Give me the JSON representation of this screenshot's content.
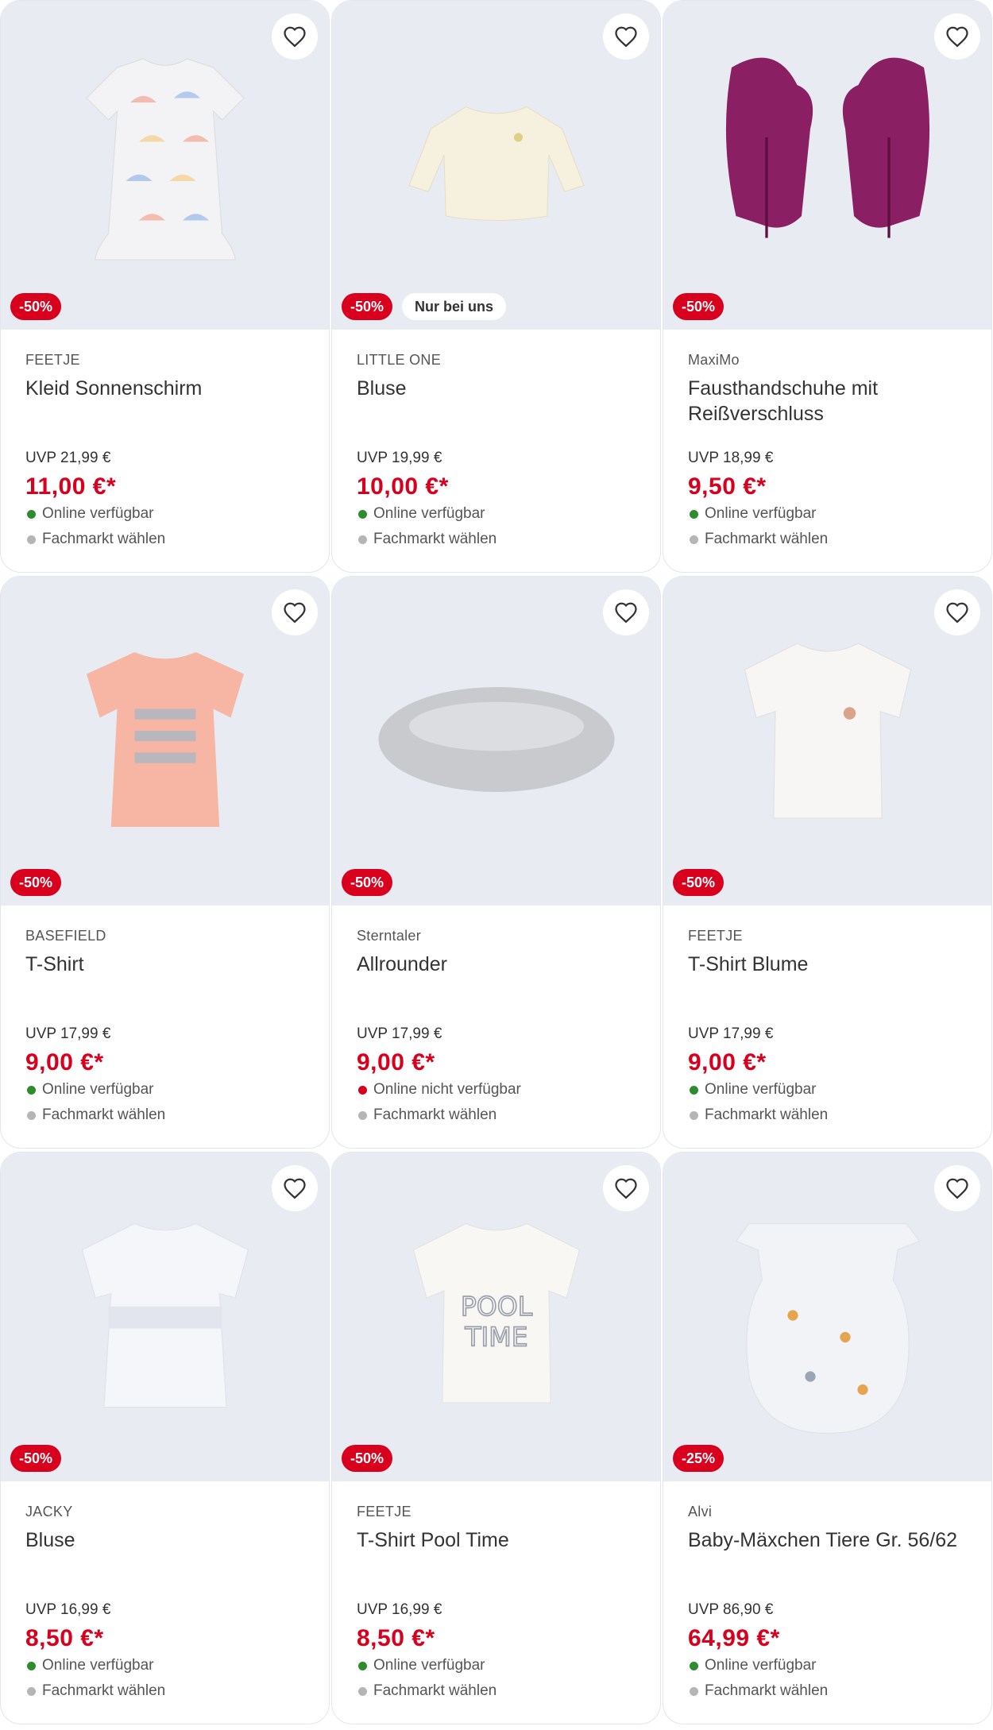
{
  "colors": {
    "accent": "#d8001c",
    "image_bg": "#e9ebf3",
    "available": "#2e8b2e",
    "unavailable": "#d8001c",
    "store_dot": "#b5b5b5"
  },
  "products": [
    {
      "image": "dress-umbrella-print",
      "discount": "-50%",
      "extra_badge": "",
      "brand": "FEETJE",
      "title": "Kleid Sonnenschirm",
      "uvp": "UVP 21,99 €",
      "price": "11,00 €*",
      "availability": "Online verfügbar",
      "available": true,
      "store": "Fachmarkt wählen"
    },
    {
      "image": "cream-blouse",
      "discount": "-50%",
      "extra_badge": "Nur bei uns",
      "brand": "LITTLE ONE",
      "title": "Bluse",
      "uvp": "UVP 19,99 €",
      "price": "10,00 €*",
      "availability": "Online verfügbar",
      "available": true,
      "store": "Fachmarkt wählen"
    },
    {
      "image": "purple-mittens",
      "discount": "-50%",
      "extra_badge": "",
      "brand": "MaxiMo",
      "title": "Fausthandschuhe mit Reißverschluss",
      "uvp": "UVP 18,99 €",
      "price": "9,50 €*",
      "availability": "Online verfügbar",
      "available": true,
      "store": "Fachmarkt wählen"
    },
    {
      "image": "peach-ruffle-tshirt",
      "discount": "-50%",
      "extra_badge": "",
      "brand": "BASEFIELD",
      "title": "T-Shirt",
      "uvp": "UVP 17,99 €",
      "price": "9,00 €*",
      "availability": "Online verfügbar",
      "available": true,
      "store": "Fachmarkt wählen"
    },
    {
      "image": "grey-loop-scarf",
      "discount": "-50%",
      "extra_badge": "",
      "brand": "Sterntaler",
      "title": "Allrounder",
      "uvp": "UVP 17,99 €",
      "price": "9,00 €*",
      "availability": "Online nicht verfügbar",
      "available": false,
      "store": "Fachmarkt wählen"
    },
    {
      "image": "white-tshirt-flower",
      "discount": "-50%",
      "extra_badge": "",
      "brand": "FEETJE",
      "title": "T-Shirt Blume",
      "uvp": "UVP 17,99 €",
      "price": "9,00 €*",
      "availability": "Online verfügbar",
      "available": true,
      "store": "Fachmarkt wählen"
    },
    {
      "image": "white-lace-blouse",
      "discount": "-50%",
      "extra_badge": "",
      "brand": "JACKY",
      "title": "Bluse",
      "uvp": "UVP 16,99 €",
      "price": "8,50 €*",
      "availability": "Online verfügbar",
      "available": true,
      "store": "Fachmarkt wählen"
    },
    {
      "image": "pool-time-tshirt",
      "discount": "-50%",
      "extra_badge": "",
      "brand": "FEETJE",
      "title": "T-Shirt Pool Time",
      "uvp": "UVP 16,99 €",
      "price": "8,50 €*",
      "availability": "Online verfügbar",
      "available": true,
      "store": "Fachmarkt wählen"
    },
    {
      "image": "baby-sleeping-bag-animals",
      "discount": "-25%",
      "extra_badge": "",
      "brand": "Alvi",
      "title": "Baby-Mäxchen Tiere Gr. 56/62",
      "uvp": "UVP 86,90 €",
      "price": "64,99 €*",
      "availability": "Online verfügbar",
      "available": true,
      "store": "Fachmarkt wählen"
    }
  ],
  "artwork_text": {
    "pool_time_print": [
      "POOL",
      "TIME"
    ]
  }
}
